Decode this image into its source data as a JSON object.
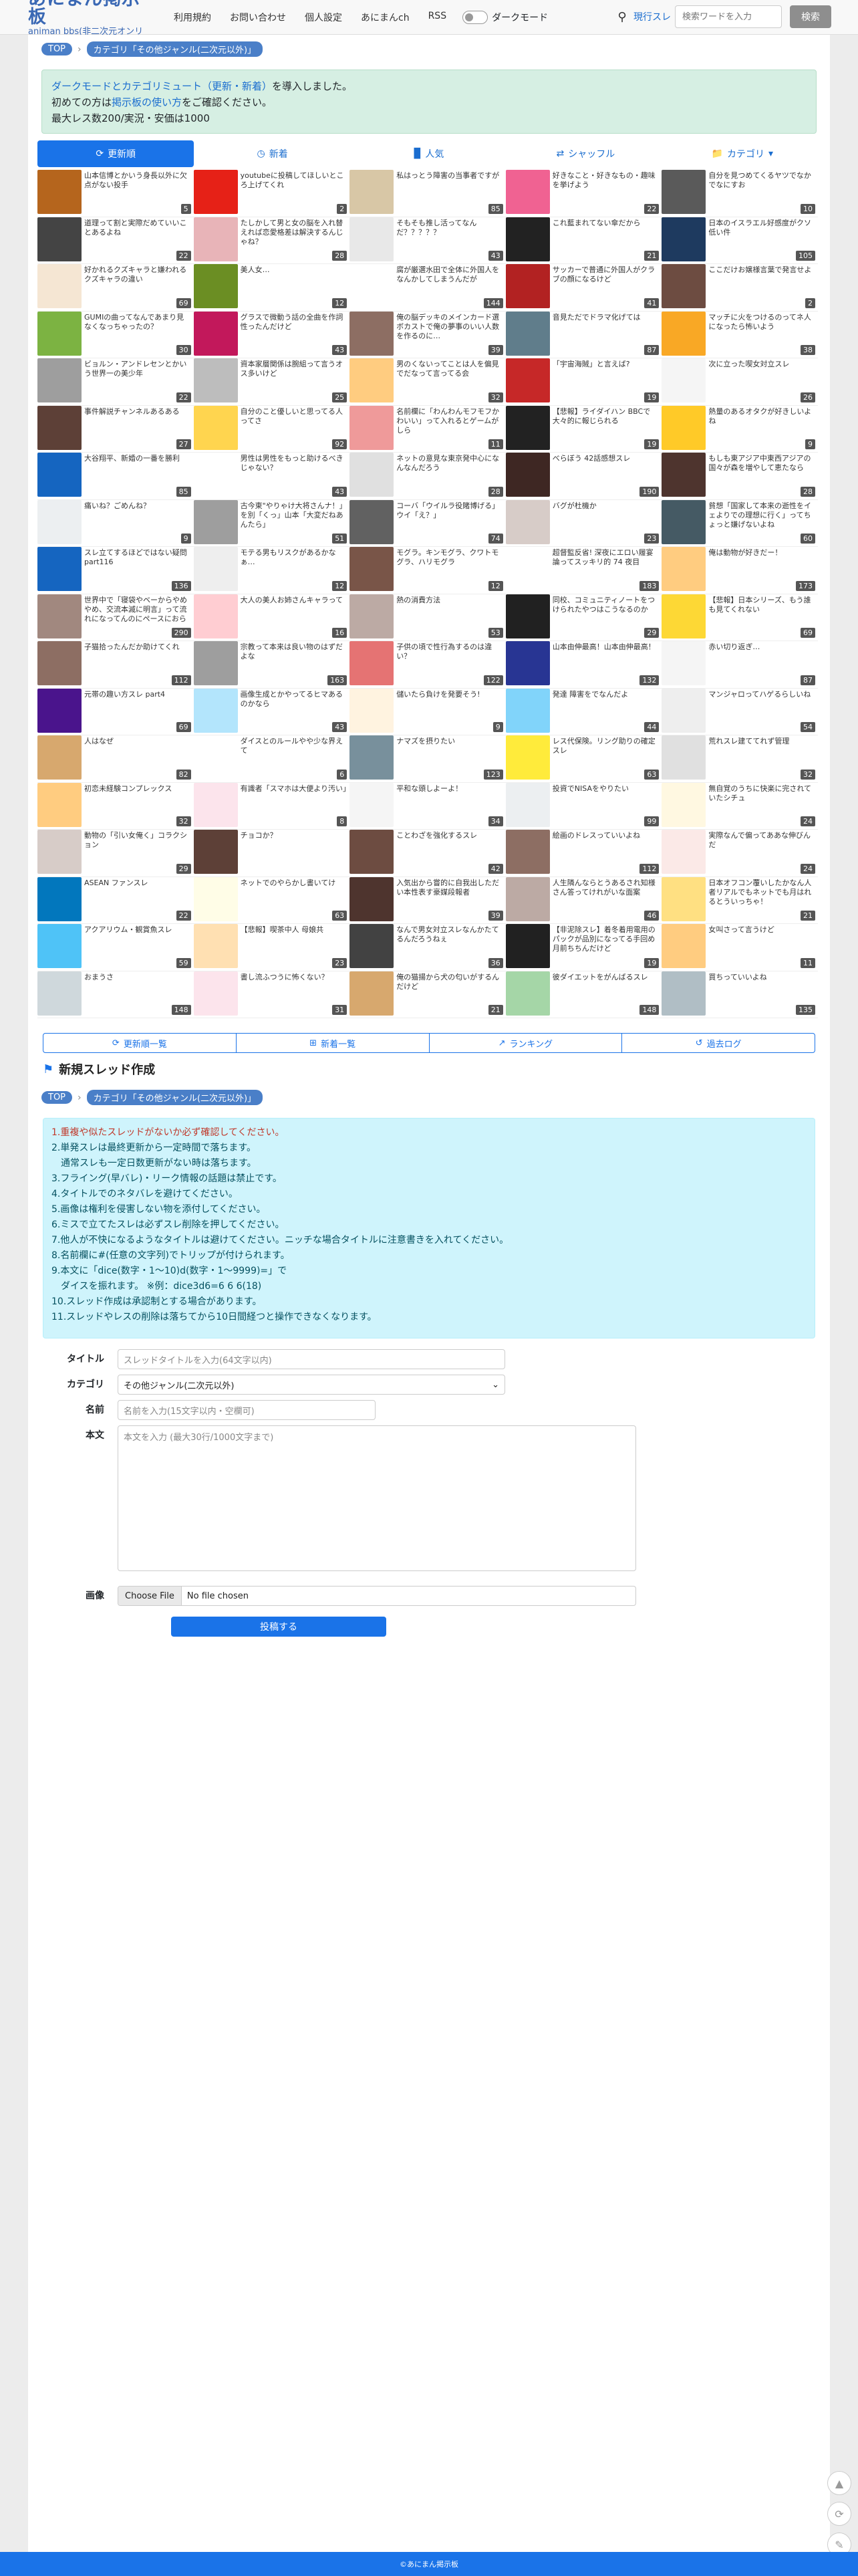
{
  "header": {
    "logo_main": "あにまん掲示板",
    "logo_sub": "animan bbs(非二次元オンリー",
    "nav": [
      "利用規約",
      "お問い合わせ",
      "個人設定",
      "あにまんch",
      "RSS"
    ],
    "dark_mode_label": "ダークモード",
    "search_category": "現行スレ",
    "search_placeholder": "検索ワードを入力",
    "search_button": "検索"
  },
  "breadcrumb": {
    "top": "TOP",
    "category": "カテゴリ「その他ジャンル(二次元以外)」"
  },
  "notice": {
    "line1_link": "ダークモードとカテゴリミュート（更新・新着）",
    "line1_rest": "を導入しました。",
    "line2_pre": "初めての方は",
    "line2_link": "掲示板の使い方",
    "line2_post": "をご確認ください。",
    "line3": "最大レス数200/実況・安価は1000"
  },
  "tabs": [
    {
      "label": "更新順",
      "icon": "refresh-icon"
    },
    {
      "label": "新着",
      "icon": "clock-icon"
    },
    {
      "label": "人気",
      "icon": "bar-chart-icon"
    },
    {
      "label": "シャッフル",
      "icon": "shuffle-icon"
    },
    {
      "label": "カテゴリ",
      "icon": "folder-icon"
    }
  ],
  "threads": [
    {
      "t": "山本信博とかいう身長以外に欠点がない投手",
      "c": "5",
      "bg": "#b5651d"
    },
    {
      "t": "youtubeに投稿してほしいところ上げてくれ",
      "c": "2",
      "bg": "#e62117"
    },
    {
      "t": "私はっとう障害の当事者ですが",
      "c": "85",
      "bg": "#d8c7a6"
    },
    {
      "t": "好きなこと・好きなもの・趣味を挙げよう",
      "c": "22",
      "bg": "#f06292"
    },
    {
      "t": "自分を見つめてくるヤツでなかでなにすお",
      "c": "10",
      "bg": "#5a5a5a"
    },
    {
      "t": "道理って割と実際だめていいことあるよね",
      "c": "22",
      "bg": "#444"
    },
    {
      "t": "たしかして男と女の脳を入れ替えれば恋愛格差は解決するんじゃね？",
      "c": "28",
      "bg": "#e8b4b8"
    },
    {
      "t": "そもそも推し活ってなんだ？？？？？",
      "c": "43",
      "bg": "#e8e8e8"
    },
    {
      "t": "これ藍まれてない傘だから",
      "c": "21",
      "bg": "#222"
    },
    {
      "t": "日本のイスラエル好感度がクソ低い件",
      "c": "105",
      "bg": "#1e3a5f"
    },
    {
      "t": "好かれるクズキャラと嫌われるクズキャラの違い",
      "c": "69",
      "bg": "#f5e6d3"
    },
    {
      "t": "美人女…",
      "c": "12",
      "bg": "#6b8e23"
    },
    {
      "t": "腐が厳選水田で全体に外国人をなんかしてしまうんだが",
      "c": "144",
      "bg": "#ffffff"
    },
    {
      "t": "サッカーで普通に外国人がクラブの顔になるけど",
      "c": "41",
      "bg": "#b22222"
    },
    {
      "t": "ここだけお嬢様言葉で発言せよ",
      "c": "2",
      "bg": "#6d4c41"
    },
    {
      "t": "GUMIの曲ってなんであまり見なくなっちゃったの？",
      "c": "30",
      "bg": "#7cb342"
    },
    {
      "t": "グラスで微動う話の全曲を作詞性ったんだけど",
      "c": "43",
      "bg": "#c2185b"
    },
    {
      "t": "俺の脳デッキのメインカード選ボカストで俺の夢事のいい人数を作るのに…",
      "c": "39",
      "bg": "#8d6e63"
    },
    {
      "t": "音見ただでドラマ化げては",
      "c": "87",
      "bg": "#607d8b"
    },
    {
      "t": "マッチに火をつけるのってネ人になったら怖いよう",
      "c": "38",
      "bg": "#f9a825"
    },
    {
      "t": "ビョルン・アンドレセンとかいう世界一の美少年",
      "c": "22",
      "bg": "#9e9e9e"
    },
    {
      "t": "資本家層関係は腕組って言うオス多いけど",
      "c": "25",
      "bg": "#bdbdbd"
    },
    {
      "t": "男のくないってことは人を偏見でだなって言ってる会",
      "c": "32",
      "bg": "#ffcc80"
    },
    {
      "t": "「宇宙海賊」と言えば?",
      "c": "19",
      "bg": "#c62828"
    },
    {
      "t": "次に立った喫女対立スレ",
      "c": "26",
      "bg": "#f5f5f5"
    },
    {
      "t": "事件解説チャンネルあるある",
      "c": "27",
      "bg": "#5d4037"
    },
    {
      "t": "自分のこと優しいと思ってる人ってさ",
      "c": "92",
      "bg": "#ffd54f"
    },
    {
      "t": "名前欄に「わんわんモフモフかわいい」って入れるとゲームがしら",
      "c": "11",
      "bg": "#ef9a9a"
    },
    {
      "t": "【悲報】ライダイハン BBCで大々的に報じられる",
      "c": "19",
      "bg": "#222"
    },
    {
      "t": "熱量のあるオタクが好きしいよね",
      "c": "9",
      "bg": "#ffca28"
    },
    {
      "t": "大谷翔平、新婚の一番を勝利",
      "c": "85",
      "bg": "#1565c0"
    },
    {
      "t": "男性は男性をもっと助けるべきじゃない？",
      "c": "43",
      "bg": "#ffffff"
    },
    {
      "t": "ネットの意見な東京発中心になんなんだろう",
      "c": "28",
      "bg": "#e0e0e0"
    },
    {
      "t": "べらぼう 42話感想スレ",
      "c": "190",
      "bg": "#3e2723"
    },
    {
      "t": "もしも東アジア中東西アジアの国々が森を増やして恵たなら",
      "c": "28",
      "bg": "#4e342e"
    },
    {
      "t": "痛いね？ごめんね？",
      "c": "9",
      "bg": "#eceff1"
    },
    {
      "t": "古今東\"やりゃけ大将さんナ！」を別「くっ」山本「大変だねあんたら」",
      "c": "51",
      "bg": "#9e9e9e"
    },
    {
      "t": "コーバ「ウイルラ役賭博げる」ウイ「え？」",
      "c": "74",
      "bg": "#616161"
    },
    {
      "t": "バグが杜機か",
      "c": "23",
      "bg": "#d7ccc8"
    },
    {
      "t": "貧想「国家して本来の逝性をイェよりでの理想に行く」ってちょっと嫌げないよね",
      "c": "60",
      "bg": "#455a64"
    },
    {
      "t": "スレ立てするほどではない疑問part116",
      "c": "136",
      "bg": "#1565c0"
    },
    {
      "t": "モテる男もリスクがあるかなぁ…",
      "c": "12",
      "bg": "#eeeeee"
    },
    {
      "t": "モグラ。キンモグラ、クワトモグラ、ハリモグラ",
      "c": "12",
      "bg": "#795548"
    },
    {
      "t": "超督監反省! 深夜にエロい履宴論ってスッキリ的 74 夜目",
      "c": "183",
      "bg": "#ffffff"
    },
    {
      "t": "俺は動物が好きだー！",
      "c": "173",
      "bg": "#ffcc80"
    },
    {
      "t": "世界中で「寝袋やベーからやめやめ、交流本滅に明言」って流れになってんのにペースにおらんくちゃ",
      "c": "290",
      "bg": "#a1887f"
    },
    {
      "t": "大人の美人お姉さんキャラって",
      "c": "16",
      "bg": "#ffcdd2"
    },
    {
      "t": "熱の消費方法",
      "c": "53",
      "bg": "#bcaaa4"
    },
    {
      "t": "同校、コミュニティノートをつけられたやつはこうなるのか",
      "c": "29",
      "bg": "#212121"
    },
    {
      "t": "【悲報】日本シリーズ、もう誰も見てくれない",
      "c": "69",
      "bg": "#fdd835"
    },
    {
      "t": "子猫拾ったんだか助けてくれ",
      "c": "112",
      "bg": "#8d6e63"
    },
    {
      "t": "宗教って本来は良い物のはずだよな",
      "c": "163",
      "bg": "#9e9e9e"
    },
    {
      "t": "子供の頃で性行為するのは違い？",
      "c": "122",
      "bg": "#e57373"
    },
    {
      "t": "山本由伸最高！山本由伸最高！",
      "c": "132",
      "bg": "#283593"
    },
    {
      "t": "赤い切り返ぎ…",
      "c": "87",
      "bg": "#f5f5f5"
    },
    {
      "t": "元帯の趣い方スレ part4",
      "c": "69",
      "bg": "#4a148c"
    },
    {
      "t": "画像生成とかやってるヒマあるのかなら",
      "c": "43",
      "bg": "#b3e5fc"
    },
    {
      "t": "儲いたら負けを発要そう!",
      "c": "9",
      "bg": "#fff3e0"
    },
    {
      "t": "発達 障害をでなんだよ",
      "c": "44",
      "bg": "#81d4fa"
    },
    {
      "t": "マンジャロってハゲるらしいね",
      "c": "54",
      "bg": "#eeeeee"
    },
    {
      "t": "人はなぜ",
      "c": "82",
      "bg": "#d7a86e"
    },
    {
      "t": "ダイスとのルールやや少な界えて",
      "c": "6",
      "bg": "#ffffff"
    },
    {
      "t": "ナマズを摂りたい",
      "c": "123",
      "bg": "#78909c"
    },
    {
      "t": "レス代保険。リング助りの確定スレ",
      "c": "63",
      "bg": "#ffeb3b"
    },
    {
      "t": "荒れスレ建ててれず管理",
      "c": "32",
      "bg": "#e0e0e0"
    },
    {
      "t": "初恋未経験コンプレックス",
      "c": "32",
      "bg": "#ffcc80"
    },
    {
      "t": "有識者「スマホは大便より汚い」",
      "c": "8",
      "bg": "#fce4ec"
    },
    {
      "t": "平和な頭しよーよ！",
      "c": "34",
      "bg": "#f5f5f5"
    },
    {
      "t": "投資でNISAをやりたい",
      "c": "99",
      "bg": "#eceff1"
    },
    {
      "t": "無自覚のうちに快楽に完されていたシチュ",
      "c": "24",
      "bg": "#fff8e1"
    },
    {
      "t": "動物の「引い女俺く」コラクション",
      "c": "29",
      "bg": "#d7ccc8"
    },
    {
      "t": "チョコか？",
      "c": "",
      "bg": "#5d4037"
    },
    {
      "t": "ことわざを強化するスレ",
      "c": "42",
      "bg": "#6d4c41"
    },
    {
      "t": "絵画のドレスっていいよね",
      "c": "112",
      "bg": "#8d6e63"
    },
    {
      "t": "実際なんで偏ってああな伸びんだ",
      "c": "24",
      "bg": "#fbe9e7"
    },
    {
      "t": "ASEAN ファンスレ",
      "c": "22",
      "bg": "#0277bd"
    },
    {
      "t": "ネットでのやらかし書いてけ",
      "c": "63",
      "bg": "#fffde7"
    },
    {
      "t": "入気出から嘗的に自我出しただい本性表す豪媒段報者",
      "c": "39",
      "bg": "#4e342e"
    },
    {
      "t": "人生隣んならとうあるされ知様さん答ってけれがいな面案",
      "c": "46",
      "bg": "#bcaaa4"
    },
    {
      "t": "日本オフコン覆いしたかなん人者リアルでもネットでも月はれるとういっちゃ！",
      "c": "21",
      "bg": "#ffe082"
    },
    {
      "t": "アクアリウム・観賞魚スレ",
      "c": "59",
      "bg": "#4fc3f7"
    },
    {
      "t": "【悲報】喫茶中人 母娘共",
      "c": "23",
      "bg": "#ffe0b2"
    },
    {
      "t": "なんで男女対立スレなんかたてるんだろうねぇ",
      "c": "36",
      "bg": "#424242"
    },
    {
      "t": "【非泥除スレ】着冬着用電用のパックが品別になってる手回め月前ちちんだけど",
      "c": "19",
      "bg": "#212121"
    },
    {
      "t": "女叫さって言うけど",
      "c": "11",
      "bg": "#ffcc80"
    },
    {
      "t": "おまうさ",
      "c": "148",
      "bg": "#cfd8dc"
    },
    {
      "t": "書し流ふつうに怖くない？",
      "c": "31",
      "bg": "#fce4ec"
    },
    {
      "t": "俺の猫揚から犬の匂いがするんだけど",
      "c": "21",
      "bg": "#d7a86e"
    },
    {
      "t": "彼ダイエットをがんばるスレ",
      "c": "148",
      "bg": "#a5d6a7"
    },
    {
      "t": "買ちっていいよね",
      "c": "135",
      "bg": "#b0bec5"
    }
  ],
  "bottom_nav": [
    "更新順一覧",
    "新着一覧",
    "ランキング",
    "過去ログ"
  ],
  "new_thread": {
    "heading": "新規スレッド作成",
    "rules": [
      "1.重複や似たスレッドがないか必ず確認してください。",
      "2.単発スレは最終更新から一定時間で落ちます。",
      "　通常スレも一定日数更新がない時は落ちます。",
      "3.フライング(早バレ)・リーク情報の話題は禁止です。",
      "4.タイトルでのネタバレを避けてください。",
      "5.画像は権利を侵害しない物を添付してください。",
      "6.ミスで立てたスレは必ずスレ削除を押してください。",
      "7.他人が不快になるようなタイトルは避けてください。ニッチな場合タイトルに注意書きを入れてください。",
      "8.名前欄に#(任意の文字列)でトリップが付けられます。",
      "9.本文に「dice(数字・1〜10)d(数字・1〜9999)=」で",
      "　ダイスを振れます。 ※例：dice3d6=6 6 6(18)",
      "10.スレッド作成は承認制とする場合があります。",
      "11.スレッドやレスの削除は落ちてから10日間経つと操作できなくなります。"
    ],
    "title_label": "タイトル",
    "title_placeholder": "スレッドタイトルを入力(64文字以内)",
    "category_label": "カテゴリ",
    "category_value": "その他ジャンル(二次元以外)",
    "name_label": "名前",
    "name_placeholder": "名前を入力(15文字以内・空欄可)",
    "body_label": "本文",
    "body_placeholder": "本文を入力 (最大30行/1000文字まで)",
    "image_label": "画像",
    "file_button": "Choose File",
    "file_status": "No file chosen",
    "submit": "投稿する"
  },
  "footer": "©あにまん掲示板"
}
